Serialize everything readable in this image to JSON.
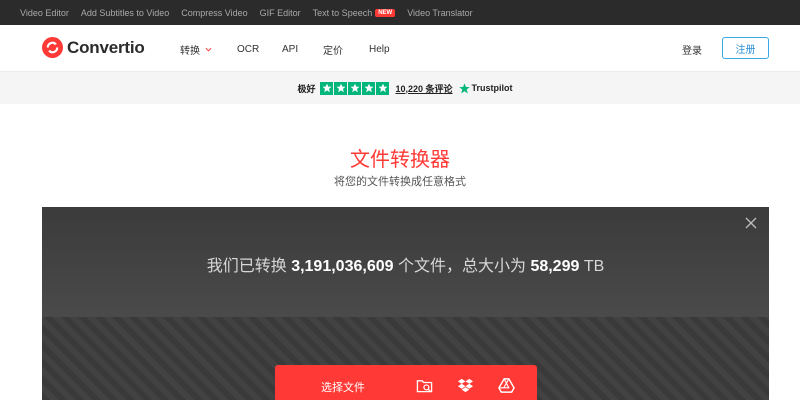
{
  "topbar": {
    "links": [
      "Video Editor",
      "Add Subtitles to Video",
      "Compress Video",
      "GIF Editor",
      "Text to Speech",
      "Video Translator"
    ],
    "new_badge": "NEW"
  },
  "header": {
    "logo": "Convertio",
    "nav": [
      "转换",
      "OCR",
      "API",
      "定价",
      "Help"
    ],
    "login": "登录",
    "signup": "注册"
  },
  "trust": {
    "label": "极好",
    "reviews": "10,220 条评论",
    "brand": "Trustpilot",
    "rating_stars": 5,
    "star_color": "#00b67a"
  },
  "hero": {
    "title": "文件转换器",
    "subtitle": "将您的文件转换成任意格式"
  },
  "stats": {
    "prefix": "我们已转换",
    "files": "3,191,036,609",
    "middle": "个文件，总大小为",
    "size": "58,299",
    "unit": "TB"
  },
  "upload": {
    "label": "选择文件"
  },
  "colors": {
    "accent": "#ff3a36",
    "link_blue": "#2b8fd6"
  }
}
